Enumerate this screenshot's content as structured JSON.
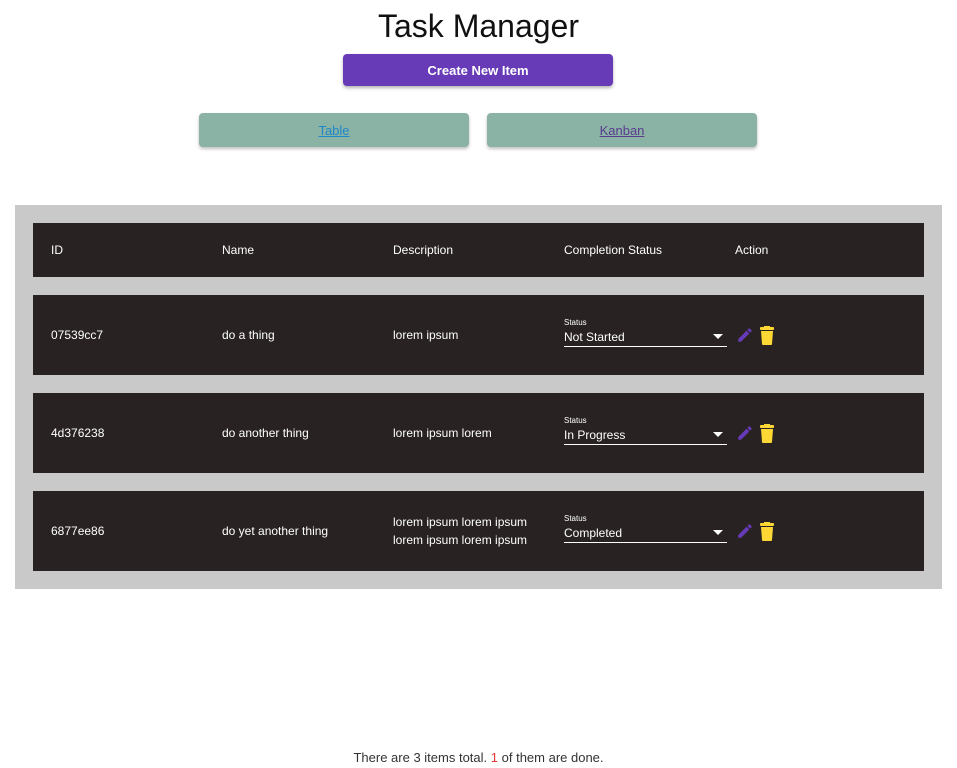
{
  "app": {
    "title": "Task Manager",
    "create_label": "Create New Item"
  },
  "views": {
    "table_label": "Table",
    "kanban_label": "Kanban"
  },
  "table": {
    "headers": {
      "id": "ID",
      "name": "Name",
      "description": "Description",
      "status": "Completion Status",
      "action": "Action"
    },
    "status_field_label": "Status",
    "rows": [
      {
        "id": "07539cc7",
        "name": "do a thing",
        "description": [
          "lorem ipsum"
        ],
        "status": "Not Started"
      },
      {
        "id": "4d376238",
        "name": "do another thing",
        "description": [
          "lorem ipsum lorem"
        ],
        "status": "In Progress"
      },
      {
        "id": "6877ee86",
        "name": "do yet another thing",
        "description": [
          "lorem ipsum lorem ipsum",
          "lorem ipsum lorem ipsum"
        ],
        "status": "Completed"
      }
    ]
  },
  "footer": {
    "prefix": "There are 3 items total.",
    "done_count": "1",
    "suffix": "of them are done."
  },
  "colors": {
    "primary": "#673ab7",
    "view_button": "#8ab2a5",
    "row_bg": "#282222",
    "table_bg": "#c9c9c9",
    "edit_icon": "#673ab7",
    "delete_icon": "#fdd835",
    "done_highlight": "#e53935"
  },
  "icons": {
    "edit": "pencil-icon",
    "delete": "trash-icon",
    "dropdown": "caret-down-icon"
  }
}
